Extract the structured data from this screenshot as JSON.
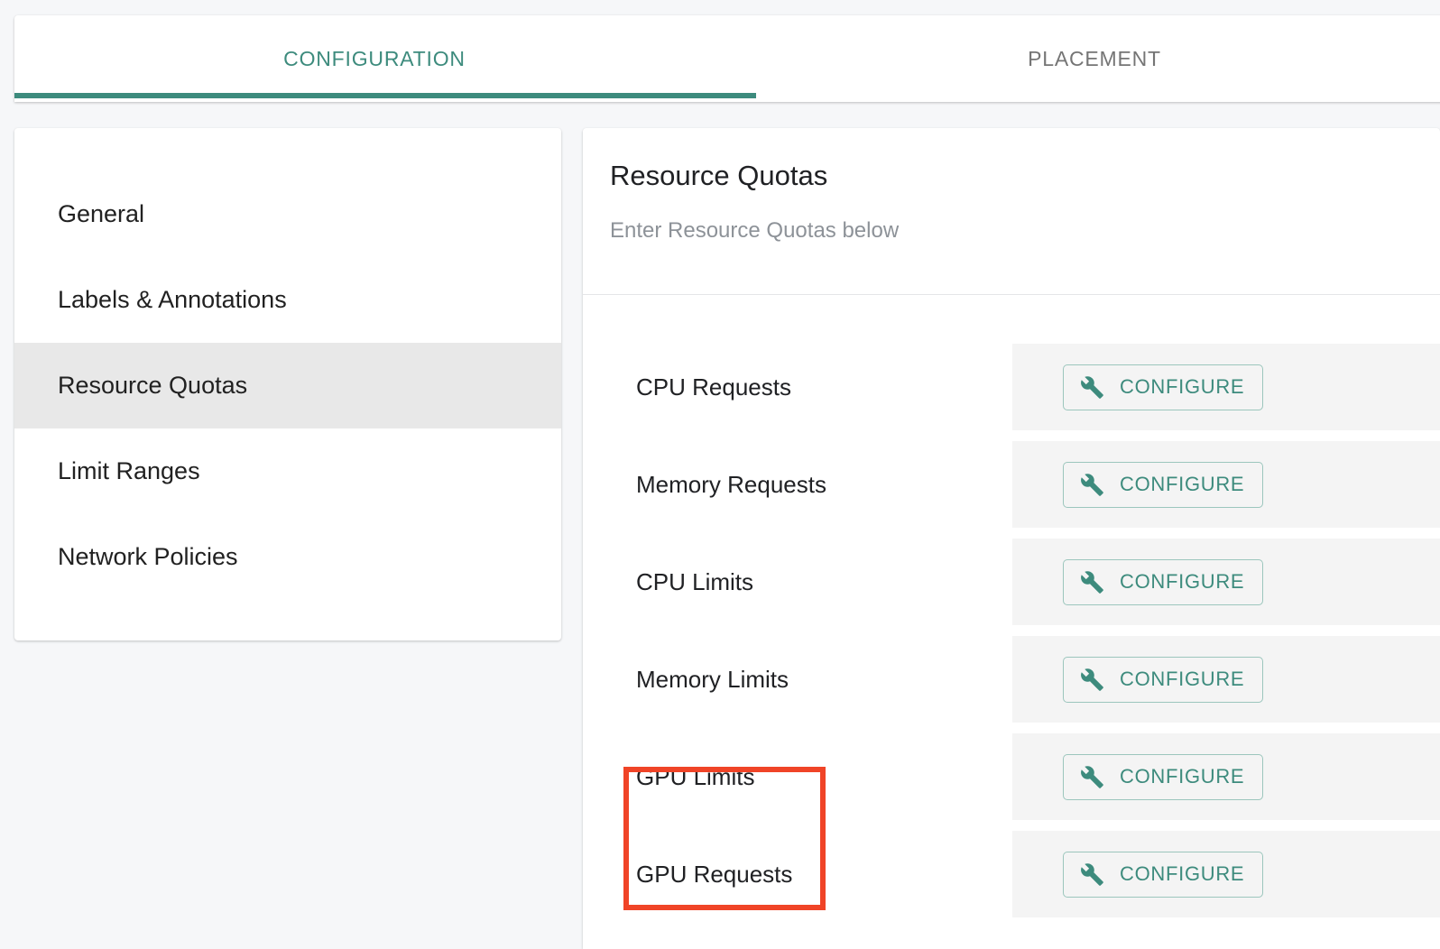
{
  "tabs": [
    {
      "label": "CONFIGURATION",
      "active": true
    },
    {
      "label": "PLACEMENT",
      "active": false
    }
  ],
  "sidebar": {
    "items": [
      {
        "label": "General",
        "selected": false
      },
      {
        "label": "Labels & Annotations",
        "selected": false
      },
      {
        "label": "Resource Quotas",
        "selected": true
      },
      {
        "label": "Limit Ranges",
        "selected": false
      },
      {
        "label": "Network Policies",
        "selected": false
      }
    ]
  },
  "content": {
    "title": "Resource Quotas",
    "subtitle": "Enter Resource Quotas below",
    "rows": [
      {
        "label": "CPU Requests",
        "action_label": "CONFIGURE",
        "action_icon": "wrench-icon"
      },
      {
        "label": "Memory Requests",
        "action_label": "CONFIGURE",
        "action_icon": "wrench-icon"
      },
      {
        "label": "CPU Limits",
        "action_label": "CONFIGURE",
        "action_icon": "wrench-icon"
      },
      {
        "label": "Memory Limits",
        "action_label": "CONFIGURE",
        "action_icon": "wrench-icon"
      },
      {
        "label": "GPU Limits",
        "action_label": "CONFIGURE",
        "action_icon": "wrench-icon"
      },
      {
        "label": "GPU Requests",
        "action_label": "CONFIGURE",
        "action_icon": "wrench-icon"
      }
    ]
  },
  "annotation": {
    "type": "rectangle-highlight",
    "color": "#f04427",
    "targets": [
      "GPU Limits",
      "GPU Requests"
    ]
  },
  "colors": {
    "accent": "#3d8b7d",
    "page_background": "#f6f7f9",
    "card_background": "#ffffff",
    "selected_nav_background": "#e8e8e8",
    "action_cell_background": "#f4f4f4",
    "button_border": "#9cc6bd",
    "inactive_tab_text": "#757575",
    "subtitle_text": "#8d9298",
    "annotation": "#f04427"
  }
}
